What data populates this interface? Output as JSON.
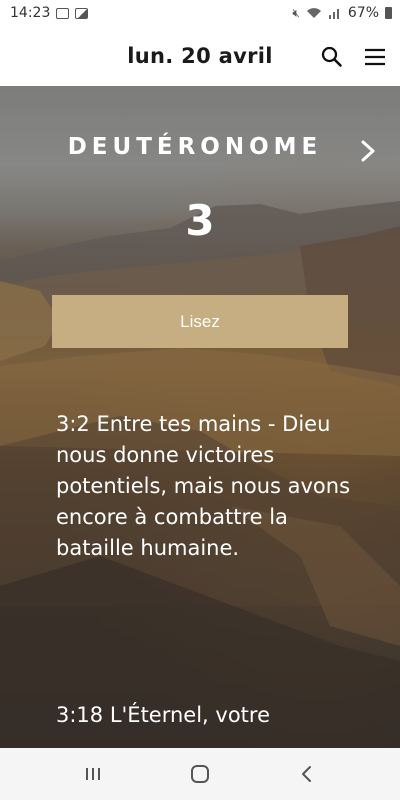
{
  "status_bar": {
    "time": "14:23",
    "battery": "67%",
    "icons": [
      "mail-icon",
      "gallery-icon",
      "mute-icon",
      "wifi-icon",
      "signal-icon",
      "battery-icon"
    ]
  },
  "header": {
    "date": "lun. 20 avril",
    "icons": [
      "search-icon",
      "menu-icon"
    ]
  },
  "hero": {
    "book": "DEUTÉRONOME",
    "chapter": "3",
    "read_button": "Lisez",
    "verses": [
      "3:2 Entre tes mains - Dieu nous donne victoires potentiels, mais nous avons encore à combattre la bataille humaine.",
      "3:18 L'Éternel, votre"
    ]
  },
  "nav_bar": {
    "icons": [
      "recent-apps-icon",
      "home-icon",
      "back-icon"
    ]
  },
  "colors": {
    "button": "#c6ad82",
    "header_bg": "#ffffff",
    "text_light": "#ffffff"
  }
}
